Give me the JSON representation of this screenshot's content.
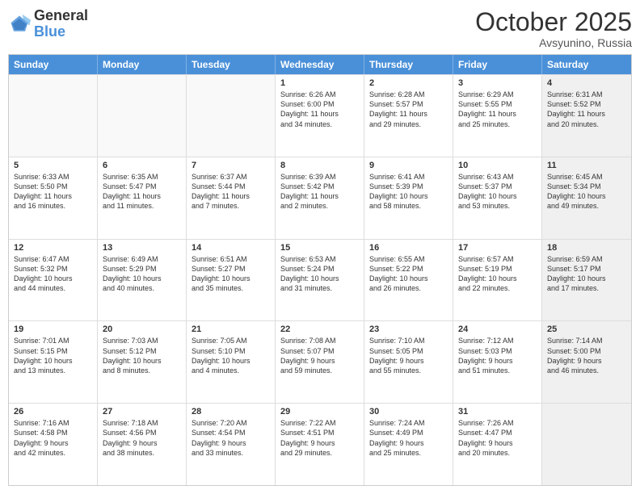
{
  "header": {
    "logo_line1": "General",
    "logo_line2": "Blue",
    "month": "October 2025",
    "location": "Avsyunino, Russia"
  },
  "days_of_week": [
    "Sunday",
    "Monday",
    "Tuesday",
    "Wednesday",
    "Thursday",
    "Friday",
    "Saturday"
  ],
  "weeks": [
    [
      {
        "day": "",
        "text": "",
        "empty": true
      },
      {
        "day": "",
        "text": "",
        "empty": true
      },
      {
        "day": "",
        "text": "",
        "empty": true
      },
      {
        "day": "1",
        "text": "Sunrise: 6:26 AM\nSunset: 6:00 PM\nDaylight: 11 hours\nand 34 minutes."
      },
      {
        "day": "2",
        "text": "Sunrise: 6:28 AM\nSunset: 5:57 PM\nDaylight: 11 hours\nand 29 minutes."
      },
      {
        "day": "3",
        "text": "Sunrise: 6:29 AM\nSunset: 5:55 PM\nDaylight: 11 hours\nand 25 minutes."
      },
      {
        "day": "4",
        "text": "Sunrise: 6:31 AM\nSunset: 5:52 PM\nDaylight: 11 hours\nand 20 minutes.",
        "shaded": true
      }
    ],
    [
      {
        "day": "5",
        "text": "Sunrise: 6:33 AM\nSunset: 5:50 PM\nDaylight: 11 hours\nand 16 minutes."
      },
      {
        "day": "6",
        "text": "Sunrise: 6:35 AM\nSunset: 5:47 PM\nDaylight: 11 hours\nand 11 minutes."
      },
      {
        "day": "7",
        "text": "Sunrise: 6:37 AM\nSunset: 5:44 PM\nDaylight: 11 hours\nand 7 minutes."
      },
      {
        "day": "8",
        "text": "Sunrise: 6:39 AM\nSunset: 5:42 PM\nDaylight: 11 hours\nand 2 minutes."
      },
      {
        "day": "9",
        "text": "Sunrise: 6:41 AM\nSunset: 5:39 PM\nDaylight: 10 hours\nand 58 minutes."
      },
      {
        "day": "10",
        "text": "Sunrise: 6:43 AM\nSunset: 5:37 PM\nDaylight: 10 hours\nand 53 minutes."
      },
      {
        "day": "11",
        "text": "Sunrise: 6:45 AM\nSunset: 5:34 PM\nDaylight: 10 hours\nand 49 minutes.",
        "shaded": true
      }
    ],
    [
      {
        "day": "12",
        "text": "Sunrise: 6:47 AM\nSunset: 5:32 PM\nDaylight: 10 hours\nand 44 minutes."
      },
      {
        "day": "13",
        "text": "Sunrise: 6:49 AM\nSunset: 5:29 PM\nDaylight: 10 hours\nand 40 minutes."
      },
      {
        "day": "14",
        "text": "Sunrise: 6:51 AM\nSunset: 5:27 PM\nDaylight: 10 hours\nand 35 minutes."
      },
      {
        "day": "15",
        "text": "Sunrise: 6:53 AM\nSunset: 5:24 PM\nDaylight: 10 hours\nand 31 minutes."
      },
      {
        "day": "16",
        "text": "Sunrise: 6:55 AM\nSunset: 5:22 PM\nDaylight: 10 hours\nand 26 minutes."
      },
      {
        "day": "17",
        "text": "Sunrise: 6:57 AM\nSunset: 5:19 PM\nDaylight: 10 hours\nand 22 minutes."
      },
      {
        "day": "18",
        "text": "Sunrise: 6:59 AM\nSunset: 5:17 PM\nDaylight: 10 hours\nand 17 minutes.",
        "shaded": true
      }
    ],
    [
      {
        "day": "19",
        "text": "Sunrise: 7:01 AM\nSunset: 5:15 PM\nDaylight: 10 hours\nand 13 minutes."
      },
      {
        "day": "20",
        "text": "Sunrise: 7:03 AM\nSunset: 5:12 PM\nDaylight: 10 hours\nand 8 minutes."
      },
      {
        "day": "21",
        "text": "Sunrise: 7:05 AM\nSunset: 5:10 PM\nDaylight: 10 hours\nand 4 minutes."
      },
      {
        "day": "22",
        "text": "Sunrise: 7:08 AM\nSunset: 5:07 PM\nDaylight: 9 hours\nand 59 minutes."
      },
      {
        "day": "23",
        "text": "Sunrise: 7:10 AM\nSunset: 5:05 PM\nDaylight: 9 hours\nand 55 minutes."
      },
      {
        "day": "24",
        "text": "Sunrise: 7:12 AM\nSunset: 5:03 PM\nDaylight: 9 hours\nand 51 minutes."
      },
      {
        "day": "25",
        "text": "Sunrise: 7:14 AM\nSunset: 5:00 PM\nDaylight: 9 hours\nand 46 minutes.",
        "shaded": true
      }
    ],
    [
      {
        "day": "26",
        "text": "Sunrise: 7:16 AM\nSunset: 4:58 PM\nDaylight: 9 hours\nand 42 minutes."
      },
      {
        "day": "27",
        "text": "Sunrise: 7:18 AM\nSunset: 4:56 PM\nDaylight: 9 hours\nand 38 minutes."
      },
      {
        "day": "28",
        "text": "Sunrise: 7:20 AM\nSunset: 4:54 PM\nDaylight: 9 hours\nand 33 minutes."
      },
      {
        "day": "29",
        "text": "Sunrise: 7:22 AM\nSunset: 4:51 PM\nDaylight: 9 hours\nand 29 minutes."
      },
      {
        "day": "30",
        "text": "Sunrise: 7:24 AM\nSunset: 4:49 PM\nDaylight: 9 hours\nand 25 minutes."
      },
      {
        "day": "31",
        "text": "Sunrise: 7:26 AM\nSunset: 4:47 PM\nDaylight: 9 hours\nand 20 minutes."
      },
      {
        "day": "",
        "text": "",
        "empty": true,
        "shaded": true
      }
    ]
  ]
}
